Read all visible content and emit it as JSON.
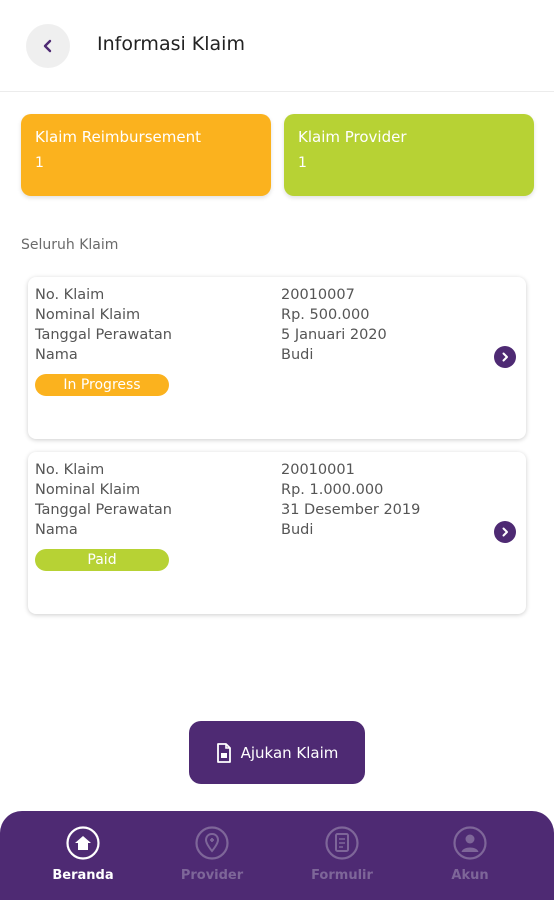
{
  "header": {
    "title": "Informasi Klaim",
    "back_icon": "chevron-left-icon"
  },
  "summary": [
    {
      "label": "Klaim Reimbursement",
      "count": "1",
      "color": "#FBB21E"
    },
    {
      "label": "Klaim Provider",
      "count": "1",
      "color": "#B7D234"
    }
  ],
  "section_title": "Seluruh Klaim",
  "claims": [
    {
      "fields": [
        {
          "label": "No. Klaim",
          "value": "20010007"
        },
        {
          "label": "Nominal Klaim",
          "value": "Rp. 500.000"
        },
        {
          "label": "Tanggal Perawatan",
          "value": "5 Januari 2020"
        },
        {
          "label": "Nama",
          "value": "Budi"
        }
      ],
      "status": "In Progress",
      "status_color": "#FBB21E"
    },
    {
      "fields": [
        {
          "label": "No. Klaim",
          "value": "20010001"
        },
        {
          "label": "Nominal Klaim",
          "value": "Rp. 1.000.000"
        },
        {
          "label": "Tanggal Perawatan",
          "value": "31 Desember 2019"
        },
        {
          "label": "Nama",
          "value": "Budi"
        }
      ],
      "status": "Paid",
      "status_color": "#B7D234"
    }
  ],
  "submit": {
    "label": "Ajukan Klaim",
    "icon": "document-icon"
  },
  "nav": [
    {
      "label": "Beranda",
      "icon": "home-icon",
      "active": true
    },
    {
      "label": "Provider",
      "icon": "location-pin-icon",
      "active": false
    },
    {
      "label": "Formulir",
      "icon": "form-icon",
      "active": false
    },
    {
      "label": "Akun",
      "icon": "user-icon",
      "active": false
    }
  ],
  "colors": {
    "primary": "#4E2A73",
    "nav_inactive": "#7E6699",
    "nav_active": "#FFFFFF"
  }
}
